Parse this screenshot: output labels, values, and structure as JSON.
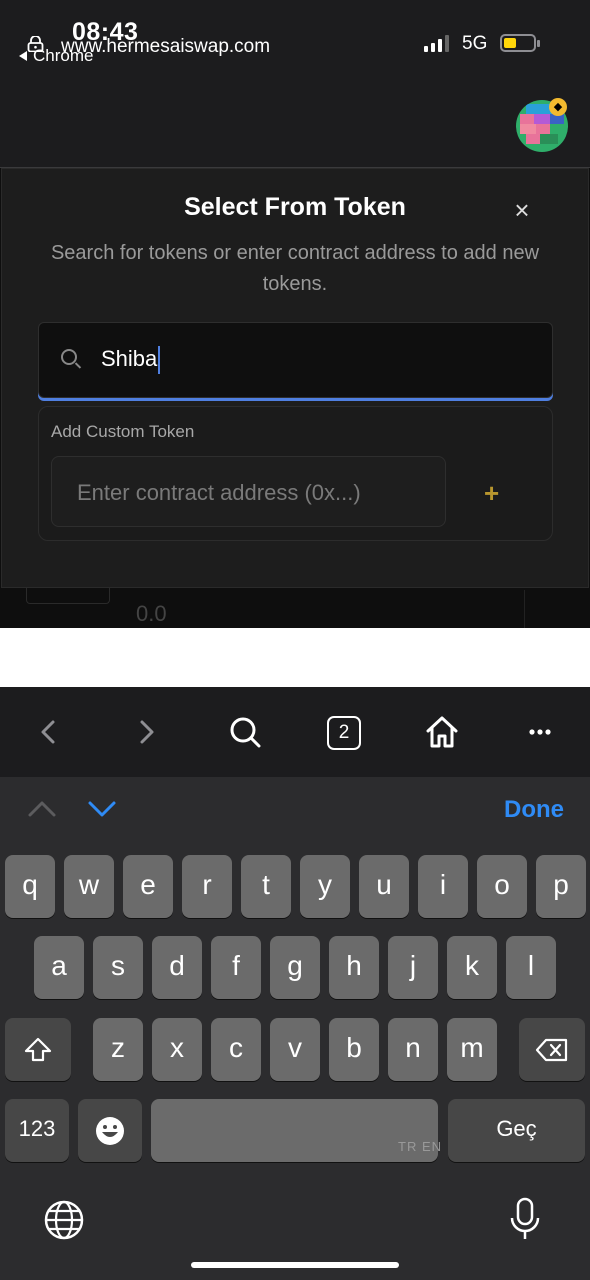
{
  "status": {
    "time": "08:43",
    "back_app": "Chrome",
    "network": "5G"
  },
  "browser": {
    "url": "www.hermesaiswap.com",
    "tabs_count": "2"
  },
  "modal": {
    "title": "Select From Token",
    "close_glyph": "×",
    "subtitle": "Search for tokens or enter contract address to add new tokens.",
    "search_value": "Shiba",
    "custom_label": "Add Custom Token",
    "address_placeholder": "Enter contract address (0x...)",
    "add_glyph": "+"
  },
  "background_page": {
    "amount": "0.0"
  },
  "keyboard": {
    "done_label": "Done",
    "row1": [
      "q",
      "w",
      "e",
      "r",
      "t",
      "y",
      "u",
      "i",
      "o",
      "p"
    ],
    "row2": [
      "a",
      "s",
      "d",
      "f",
      "g",
      "h",
      "j",
      "k",
      "l"
    ],
    "row3": [
      "z",
      "x",
      "c",
      "v",
      "b",
      "n",
      "m"
    ],
    "numbers_label": "123",
    "go_label": "Geç",
    "space_tag": "TR EN"
  },
  "colors": {
    "accent_blue": "#2f8bf5",
    "plus_gold": "#b8962e",
    "battery_yellow": "#ffd60a"
  }
}
